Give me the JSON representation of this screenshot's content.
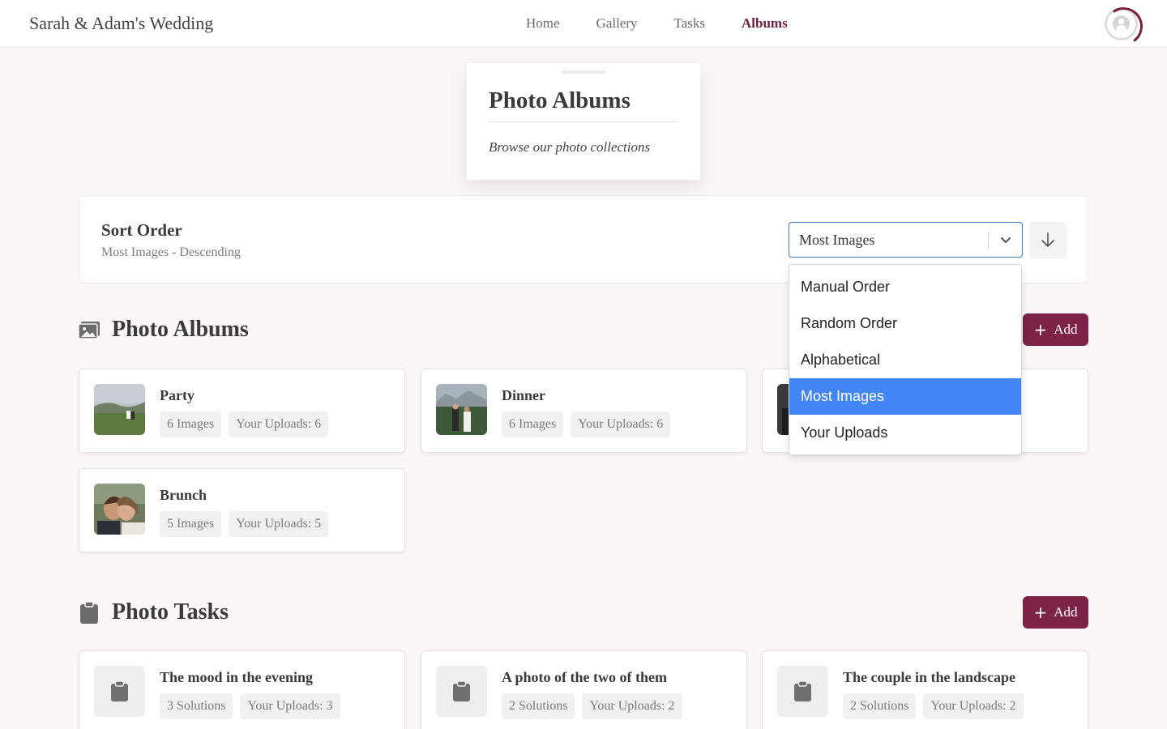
{
  "brand": "Sarah & Adam's Wedding",
  "nav": [
    {
      "label": "Home"
    },
    {
      "label": "Gallery"
    },
    {
      "label": "Tasks"
    },
    {
      "label": "Albums"
    }
  ],
  "hero": {
    "title": "Photo Albums",
    "subtitle": "Browse our photo collections"
  },
  "sort": {
    "title": "Sort Order",
    "subtitle": "Most Images - Descending",
    "selected": "Most Images",
    "options": [
      "Manual Order",
      "Random Order",
      "Alphabetical",
      "Most Images",
      "Your Uploads"
    ]
  },
  "albums": {
    "heading": "Photo Albums",
    "add_label": "Add",
    "items": [
      {
        "title": "Party",
        "count": "6 Images",
        "uploads": "Your Uploads: 6"
      },
      {
        "title": "Dinner",
        "count": "6 Images",
        "uploads": "Your Uploads: 6"
      },
      {
        "title": "",
        "count": "",
        "uploads": ""
      },
      {
        "title": "Brunch",
        "count": "5 Images",
        "uploads": "Your Uploads: 5"
      }
    ]
  },
  "tasks": {
    "heading": "Photo Tasks",
    "add_label": "Add",
    "items": [
      {
        "title": "The mood in the evening",
        "count": "3 Solutions",
        "uploads": "Your Uploads: 3"
      },
      {
        "title": "A photo of the two of them",
        "count": "2 Solutions",
        "uploads": "Your Uploads: 2"
      },
      {
        "title": "The couple in the landscape",
        "count": "2 Solutions",
        "uploads": "Your Uploads: 2"
      }
    ]
  },
  "colors": {
    "accent": "#7c2347",
    "dropdown_selected": "#4285f4",
    "background": "#fcf6f6"
  }
}
